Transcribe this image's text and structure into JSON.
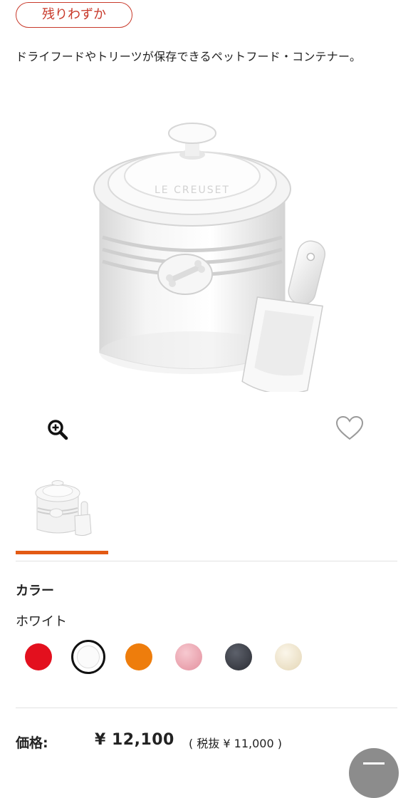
{
  "badge": {
    "label": "残りわずか"
  },
  "product": {
    "description": "ドライフードやトリーツが保存できるペットフード・コンテナー。",
    "lid_emboss": "LE CREUSET"
  },
  "color": {
    "title": "カラー",
    "selected_name": "ホワイト",
    "swatches": [
      {
        "name": "red",
        "hex": "#e3101e"
      },
      {
        "name": "white",
        "hex": "#fbfbfb",
        "selected": true
      },
      {
        "name": "orange",
        "hex": "#ee7d0c"
      },
      {
        "name": "pink",
        "hex": "#eba2ae"
      },
      {
        "name": "graphite",
        "hex": "#3c3f47"
      },
      {
        "name": "cream",
        "hex": "#efe6cf"
      }
    ]
  },
  "price": {
    "label": "価格:",
    "value": "¥ 12,100",
    "tax_note": "( 税抜 ¥ 11,000 )"
  },
  "icons": {
    "zoom": "zoom-in-icon",
    "favorite": "heart-outline-icon",
    "menu": "menu-icon"
  },
  "theme": {
    "accent": "#e35a14",
    "badge": "#c83a2b"
  }
}
